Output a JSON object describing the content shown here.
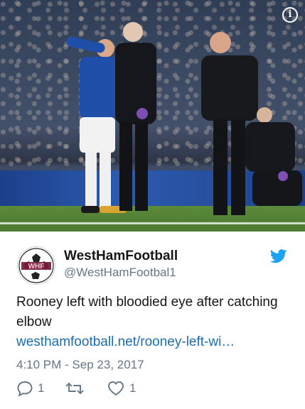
{
  "photo": {
    "alt": "",
    "info_icon": "info-icon"
  },
  "tweet": {
    "display_name": "WestHamFootball",
    "handle": "@WestHamFootbal1",
    "avatar_label": "WHF",
    "text": "Rooney left with bloodied eye after catching elbow",
    "link": "westhamfootball.net/rooney-left-wi…",
    "timestamp": "4:10 PM - Sep 23, 2017",
    "reply_count": "1",
    "like_count": "1",
    "retweet_count": ""
  },
  "colors": {
    "twitter_blue": "#1da1f2",
    "link": "#1b6eb2",
    "muted": "#657786",
    "text": "#14171a"
  }
}
